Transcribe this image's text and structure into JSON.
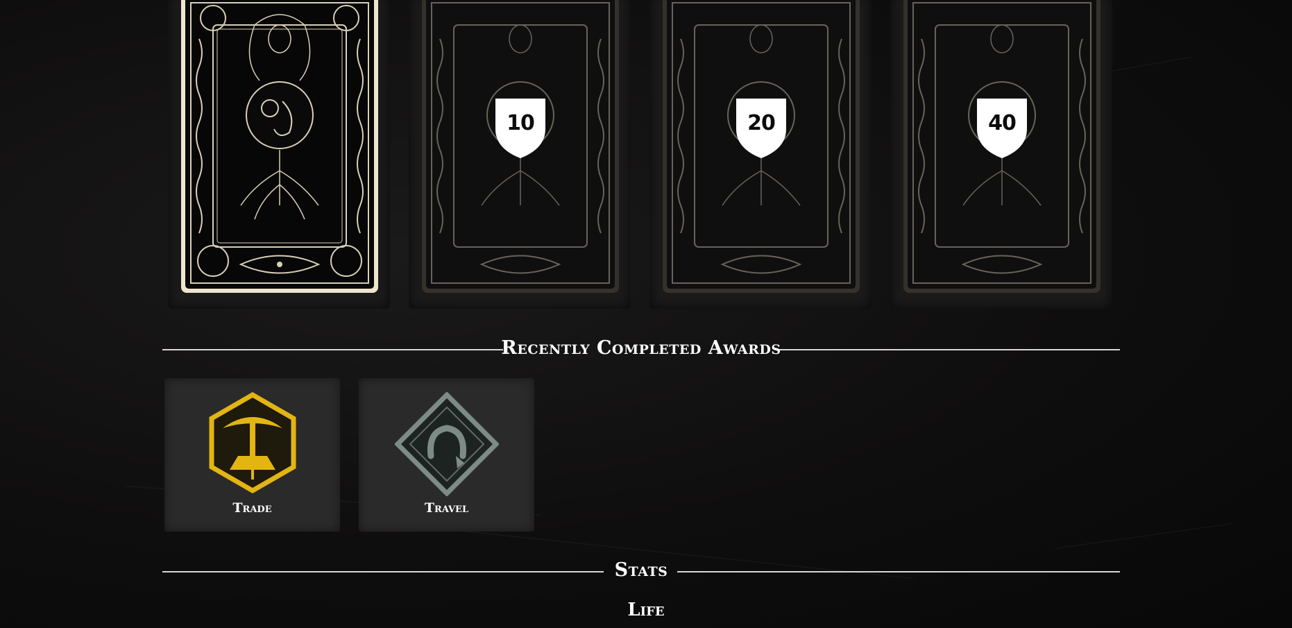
{
  "cards": [
    {
      "state": "unlocked",
      "requirement": ""
    },
    {
      "state": "locked",
      "requirement": "10"
    },
    {
      "state": "locked",
      "requirement": "20"
    },
    {
      "state": "locked",
      "requirement": "40"
    }
  ],
  "recent_awards": {
    "heading": "Recently Completed Awards",
    "items": [
      {
        "label": "Trade",
        "icon": "pickaxe-hexagon-icon",
        "color": "#e3b512"
      },
      {
        "label": "Travel",
        "icon": "horseshoe-diamond-icon",
        "color": "#7d8b87"
      }
    ]
  },
  "stats": {
    "heading": "Stats",
    "subheading": "Life"
  }
}
